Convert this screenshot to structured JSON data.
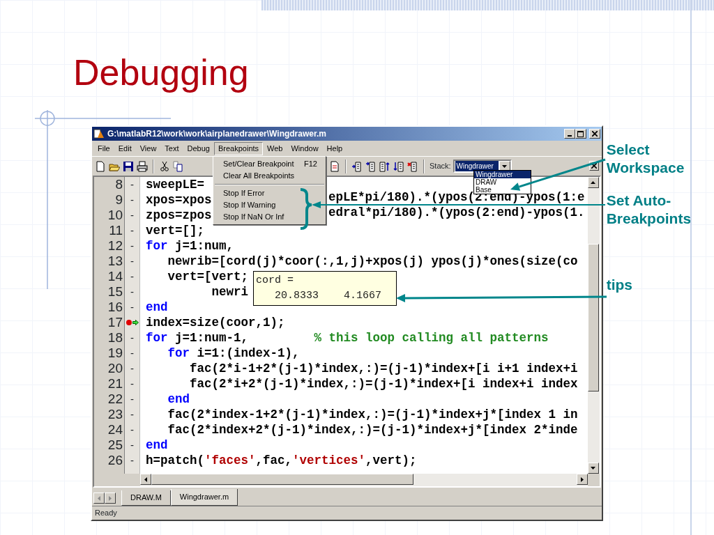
{
  "slide": {
    "title": "Debugging"
  },
  "window": {
    "title": "G:\\matlabR12\\work\\work\\airplanedrawer\\Wingdrawer.m",
    "menu": [
      {
        "label": "File",
        "selected": false
      },
      {
        "label": "Edit",
        "selected": false
      },
      {
        "label": "View",
        "selected": false
      },
      {
        "label": "Text",
        "selected": false
      },
      {
        "label": "Debug",
        "selected": false
      },
      {
        "label": "Breakpoints",
        "selected": true
      },
      {
        "label": "Web",
        "selected": false
      },
      {
        "label": "Window",
        "selected": false
      },
      {
        "label": "Help",
        "selected": false
      }
    ],
    "breakpoints_menu": [
      {
        "kind": "item",
        "label": "Set/Clear Breakpoint",
        "shortcut": "F12"
      },
      {
        "kind": "item",
        "label": "Clear All Breakpoints"
      },
      {
        "kind": "separator"
      },
      {
        "kind": "item",
        "label": "Stop If Error"
      },
      {
        "kind": "item",
        "label": "Stop If Warning"
      },
      {
        "kind": "item",
        "label": "Stop If NaN Or Inf"
      }
    ],
    "stack": {
      "label": "Stack:",
      "value": "Wingdrawer",
      "options": [
        {
          "label": "Wingdrawer",
          "selected": true
        },
        {
          "label": "DRAW",
          "selected": false
        },
        {
          "label": "Base",
          "selected": false
        }
      ]
    },
    "code_lines": [
      {
        "number": "8",
        "marker": "-",
        "breakpoint": false,
        "current": false,
        "segments": [
          {
            "kind": "plain",
            "text": "sweepLE="
          }
        ]
      },
      {
        "number": "9",
        "marker": "-",
        "breakpoint": false,
        "current": false,
        "segments": [
          {
            "kind": "plain",
            "text": "xpos=xpos"
          }
        ],
        "tail": [
          {
            "kind": "plain",
            "text": "epLE*pi/180).*(ypos(2:end)-ypos(1:e"
          }
        ]
      },
      {
        "number": "10",
        "marker": "-",
        "breakpoint": false,
        "current": false,
        "segments": [
          {
            "kind": "plain",
            "text": "zpos=zpos"
          }
        ],
        "tail": [
          {
            "kind": "plain",
            "text": "edral*pi/180).*(ypos(2:end)-ypos(1."
          }
        ]
      },
      {
        "number": "11",
        "marker": "-",
        "breakpoint": false,
        "current": false,
        "segments": [
          {
            "kind": "plain",
            "text": "vert=[];"
          }
        ]
      },
      {
        "number": "12",
        "marker": "-",
        "breakpoint": false,
        "current": false,
        "segments": [
          {
            "kind": "keyword",
            "text": "for"
          },
          {
            "kind": "plain",
            "text": " j=1:num,"
          }
        ]
      },
      {
        "number": "13",
        "marker": "-",
        "breakpoint": false,
        "current": false,
        "segments": [
          {
            "kind": "plain",
            "text": "   newrib=[cord(j)*coor(:,1,j)+xpos(j) ypos(j)*ones(size(co"
          }
        ]
      },
      {
        "number": "14",
        "marker": "-",
        "breakpoint": false,
        "current": false,
        "segments": [
          {
            "kind": "plain",
            "text": "   vert=[vert;"
          }
        ]
      },
      {
        "number": "15",
        "marker": "-",
        "breakpoint": false,
        "current": false,
        "segments": [
          {
            "kind": "plain",
            "text": "         newri"
          }
        ]
      },
      {
        "number": "16",
        "marker": "-",
        "breakpoint": false,
        "current": false,
        "segments": [
          {
            "kind": "keyword",
            "text": "end"
          }
        ]
      },
      {
        "number": "17",
        "breakpoint": true,
        "current": true,
        "segments": [
          {
            "kind": "plain",
            "text": "index=size(coor,1);"
          }
        ]
      },
      {
        "number": "18",
        "marker": "-",
        "breakpoint": false,
        "current": false,
        "segments": [
          {
            "kind": "keyword",
            "text": "for"
          },
          {
            "kind": "plain",
            "text": " j=1:num-1,         "
          },
          {
            "kind": "comment",
            "text": "% this loop calling all patterns"
          }
        ]
      },
      {
        "number": "19",
        "marker": "-",
        "breakpoint": false,
        "current": false,
        "segments": [
          {
            "kind": "keyword",
            "text": "   for"
          },
          {
            "kind": "plain",
            "text": " i=1:(index-1),"
          }
        ]
      },
      {
        "number": "20",
        "marker": "-",
        "breakpoint": false,
        "current": false,
        "segments": [
          {
            "kind": "plain",
            "text": "      fac(2*i-1+2*(j-1)*index,:)=(j-1)*index+[i i+1 index+i"
          }
        ]
      },
      {
        "number": "21",
        "marker": "-",
        "breakpoint": false,
        "current": false,
        "segments": [
          {
            "kind": "plain",
            "text": "      fac(2*i+2*(j-1)*index,:)=(j-1)*index+[i index+i index"
          }
        ]
      },
      {
        "number": "22",
        "marker": "-",
        "breakpoint": false,
        "current": false,
        "segments": [
          {
            "kind": "keyword",
            "text": "   end"
          }
        ]
      },
      {
        "number": "23",
        "marker": "-",
        "breakpoint": false,
        "current": false,
        "segments": [
          {
            "kind": "plain",
            "text": "   fac(2*index-1+2*(j-1)*index,:)=(j-1)*index+j*[index 1 in"
          }
        ]
      },
      {
        "number": "24",
        "marker": "-",
        "breakpoint": false,
        "current": false,
        "segments": [
          {
            "kind": "plain",
            "text": "   fac(2*index+2*(j-1)*index,:)=(j-1)*index+j*[index 2*inde"
          }
        ]
      },
      {
        "number": "25",
        "marker": "-",
        "breakpoint": false,
        "current": false,
        "segments": [
          {
            "kind": "keyword",
            "text": "end"
          }
        ]
      },
      {
        "number": "26",
        "marker": "-",
        "breakpoint": false,
        "current": false,
        "segments": [
          {
            "kind": "plain",
            "text": "h=patch("
          },
          {
            "kind": "string",
            "text": "'faces'"
          },
          {
            "kind": "plain",
            "text": ",fac,"
          },
          {
            "kind": "string",
            "text": "'vertices'"
          },
          {
            "kind": "plain",
            "text": ",vert);"
          }
        ]
      }
    ],
    "tooltip": {
      "lines": [
        "cord =",
        "   20.8333    4.1667"
      ]
    },
    "file_tabs": [
      {
        "label": "DRAW.M",
        "selected": false
      },
      {
        "label": "Wingdrawer.m",
        "selected": true
      }
    ],
    "status_bar": "Ready"
  },
  "annotations": [
    {
      "text": "Select Workspace"
    },
    {
      "text": "Set Auto-Breakpoints"
    },
    {
      "text": "tips"
    }
  ]
}
